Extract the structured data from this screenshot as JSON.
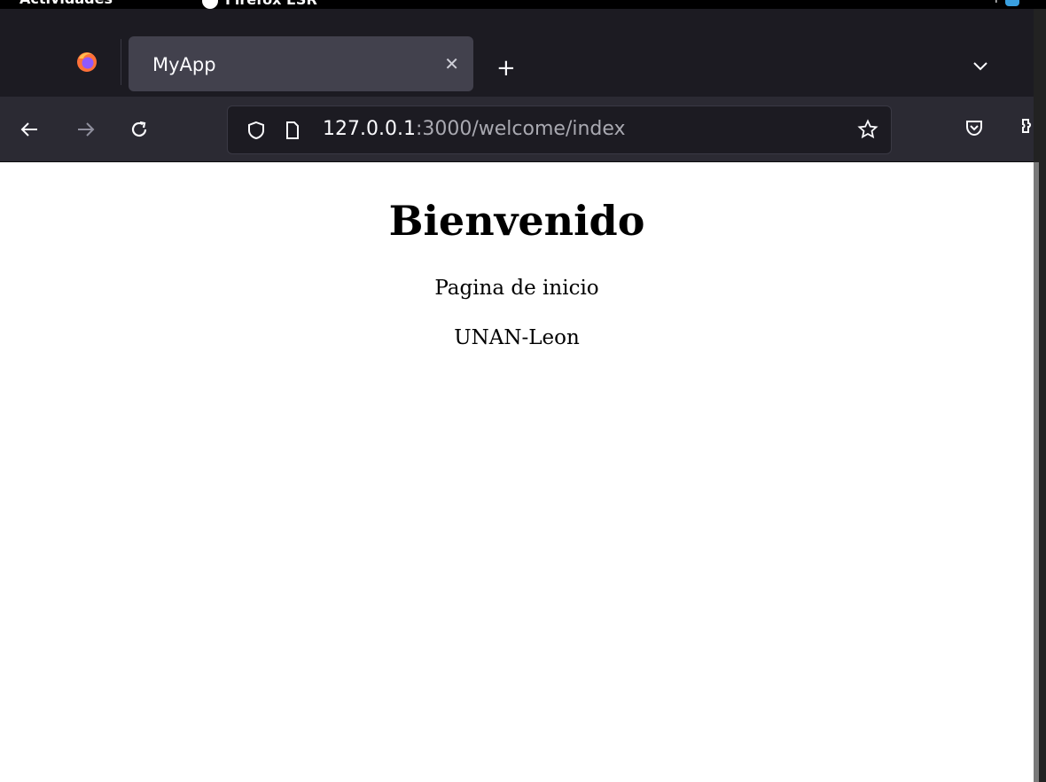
{
  "os_topbar": {
    "activities": "Actividades",
    "app_name": "Firefox ESR"
  },
  "browser": {
    "tab": {
      "title": "MyApp"
    },
    "url": {
      "host": "127.0.0.1",
      "rest": ":3000/welcome/index"
    }
  },
  "page": {
    "heading": "Bienvenido",
    "paragraphs": [
      "Pagina de inicio",
      "UNAN-Leon"
    ]
  },
  "colors": {
    "tabstrip_bg": "#1c1b22",
    "navbar_bg": "#2b2a33",
    "active_tab_bg": "#42414d",
    "page_bg": "#ffffff"
  },
  "icons": {
    "browser_logo": "firefox-icon",
    "tab_close": "close-icon",
    "new_tab": "plus-icon",
    "list_tabs": "chevron-down-icon",
    "back": "back-arrow-icon",
    "forward": "forward-arrow-icon",
    "reload": "reload-icon",
    "tracking": "shield-icon",
    "page_info": "page-icon",
    "bookmark": "star-icon",
    "pocket": "pocket-icon",
    "extensions": "extensions-icon"
  }
}
